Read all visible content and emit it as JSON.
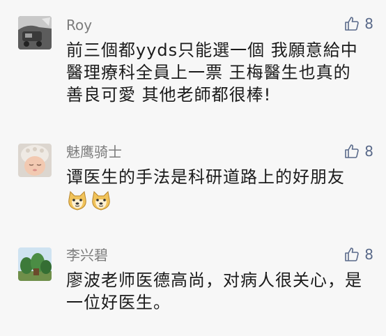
{
  "comments": [
    {
      "name": "Roy",
      "likes": "8",
      "text_lines": [
        "前三個都yyds只能選一個 我願意給中",
        "醫理療科全員上一票  王梅醫生也真的",
        "善良可愛 其他老師都很棒!"
      ],
      "avatar_icon": "car-photo-avatar"
    },
    {
      "name": "魅鹰骑士",
      "likes": "8",
      "text_lines": [
        "谭医生的手法是科研道路上的好朋友"
      ],
      "emojis": [
        "doge-emoji",
        "doge-emoji"
      ],
      "avatar_icon": "baby-photo-avatar"
    },
    {
      "name": "李兴碧",
      "likes": "8",
      "text_lines": [
        "廖波老师医德高尚，对病人很关心，是",
        "一位好医生。"
      ],
      "avatar_icon": "garden-photo-avatar"
    }
  ],
  "colors": {
    "background": "#f7f7f7",
    "name": "#7c7c7c",
    "text": "#1b1b1b",
    "like": "#5a6a8a"
  }
}
